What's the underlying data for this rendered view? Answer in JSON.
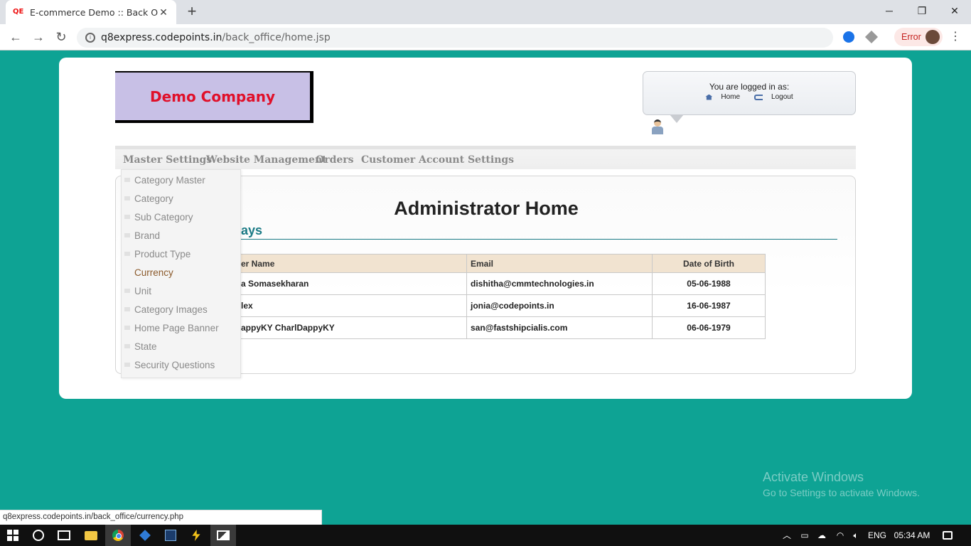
{
  "browser": {
    "tab_title": "E-commerce Demo :: Back Office",
    "favicon_text": "QE",
    "url_host": "q8express.codepoints.in",
    "url_path": "/back_office/home.jsp",
    "error_label": "Error",
    "status_url": "q8express.codepoints.in/back_office/currency.php"
  },
  "header": {
    "company_name": "Demo Company",
    "logged_in_label": "You are logged in as:",
    "home_link": "Home",
    "logout_link": "Logout"
  },
  "nav": {
    "items": [
      "Master Settings",
      "Website Management",
      "Orders",
      "Customer",
      "Account Settings"
    ]
  },
  "dropdown": {
    "items": [
      "Category Master",
      "Category",
      "Sub Category",
      "Brand",
      "Product Type",
      "Currency",
      "Unit",
      "Category Images",
      "Home Page Banner",
      "State",
      "Security Questions"
    ],
    "active": "Currency"
  },
  "main": {
    "title": "Administrator Home",
    "section_heading_visible": "ays",
    "table": {
      "headers": [
        "er Name",
        "Email",
        "Date of Birth"
      ],
      "rows": [
        [
          "a Somasekharan",
          "dishitha@cmmtechnologies.in",
          "05-06-1988"
        ],
        [
          "lex",
          "jonia@codepoints.in",
          "16-06-1987"
        ],
        [
          "appyKY CharlDappyKY",
          "san@fastshipcialis.com",
          "06-06-1979"
        ]
      ]
    }
  },
  "watermark": {
    "line1": "Activate Windows",
    "line2": "Go to Settings to activate Windows."
  },
  "taskbar": {
    "language": "ENG",
    "time": "05:34 AM"
  },
  "colors": {
    "page_background": "#0ea394",
    "company_name": "#e0102a",
    "section_heading": "#1a7a85",
    "active_menu_item": "#8b5a2b"
  }
}
